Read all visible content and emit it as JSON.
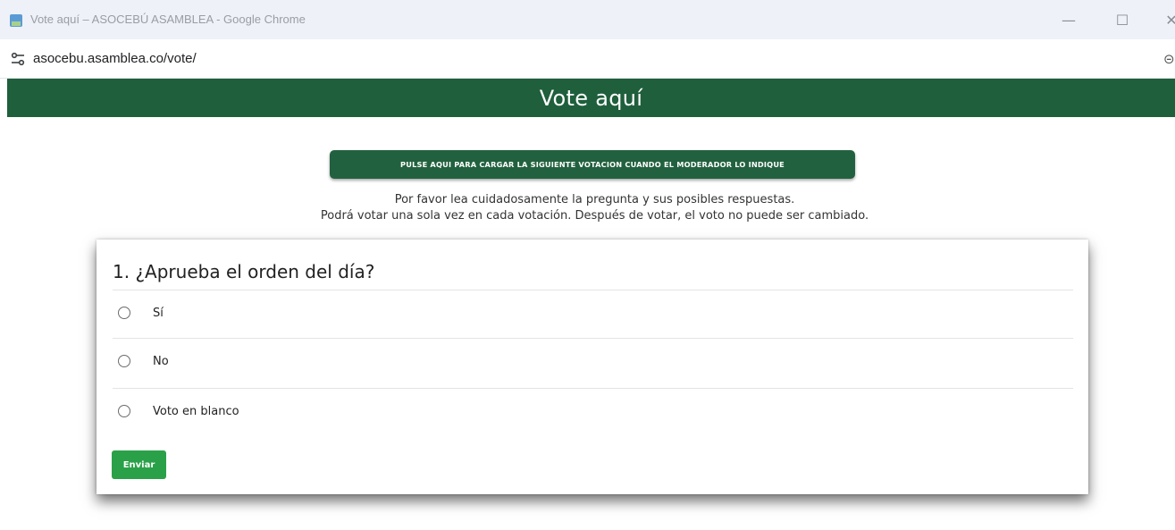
{
  "browser": {
    "window_title": "Vote aquí – ASOCEBÚ ASAMBLEA - Google Chrome",
    "url": "asocebu.asamblea.co/vote/",
    "controls": {
      "minimize": "—",
      "maximize": "☐",
      "close": "✕"
    },
    "right_icon": "⊝"
  },
  "header": {
    "title": "Vote aquí"
  },
  "load_button": {
    "label": "PULSE AQUI PARA CARGAR LA SIGUIENTE VOTACION CUANDO EL MODERADOR LO INDIQUE"
  },
  "instructions": {
    "line1": "Por favor lea cuidadosamente la pregunta y sus posibles respuestas.",
    "line2": "Podrá votar una sola vez en cada votación.  Después de votar, el voto no puede ser cambiado."
  },
  "question": {
    "title": "1. ¿Aprueba el orden del día?",
    "options": [
      {
        "label": "Sí",
        "selected": false
      },
      {
        "label": "No",
        "selected": false
      },
      {
        "label": "Voto en blanco",
        "selected": false
      }
    ],
    "submit_label": "Enviar"
  },
  "colors": {
    "header_bg": "#1f5f3c",
    "load_button_bg": "#22613f",
    "submit_bg": "#2aa148"
  },
  "icons": {
    "favicon": "page-favicon-icon",
    "site_settings": "tune-icon"
  }
}
